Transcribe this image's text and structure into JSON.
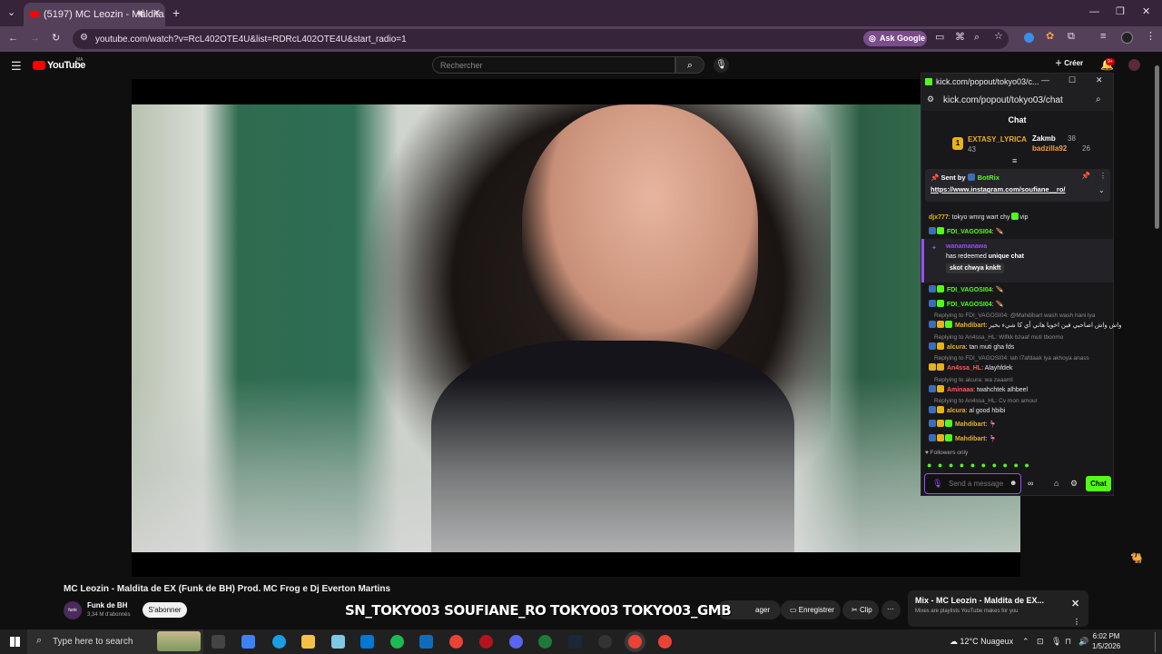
{
  "browser": {
    "tab_title": "(5197) MC Leozin - Maldita",
    "url": "youtube.com/watch?v=RcL402OTE4U&list=RDRcL402OTE4U&start_radio=1",
    "ask_google": "Ask Google",
    "new_tab": "+"
  },
  "youtube": {
    "logo": "YouTube",
    "region": "MA",
    "search_placeholder": "Rechercher",
    "create_label": "Créer",
    "notification_count": "9+"
  },
  "kick": {
    "window_title": "kick.com/popout/tokyo03/c...",
    "url": "kick.com/popout/tokyo03/chat",
    "chat_header": "Chat",
    "leaderboard": {
      "first": {
        "name": "EXTASY_LYRICA",
        "score": "43"
      },
      "second": {
        "name": "Zakmb",
        "score": "38"
      },
      "third": {
        "name": "badzilla92",
        "score": "26"
      },
      "rank_badge": "1"
    },
    "pinned": {
      "sent_by": "Sent by",
      "bot": "BotRix",
      "link": "https://www.instagram.com/soufiane__ro/"
    },
    "messages": {
      "m1_user": "djx777",
      "m1_text": ": tokyo wmrg wart chy",
      "m1_tail": "vip",
      "m2_user": "FDI_VAGOSI04",
      "redeem_user": "wanamanawa",
      "redeem_text": "has redeemed",
      "redeem_item": "unique chat",
      "redeem_msg": "skot chwya knkft",
      "m3_user": "FDI_VAGOSI04",
      "m4_user": "FDI_VAGOSI04",
      "r5": "Replying to FDI_VAGOSI04: @Mahdibart wash wash hani lya",
      "m5_user": "Mahdibart",
      "m5_text": ": واش واش اصاحبي فين اخويا هاني أي كا شيء بخير",
      "r6": "Replying to An4ssa_HL: Wlfkk bzaaf muti tbonmo",
      "m6_user": "alcura",
      "m6_text": ": tan muti gha fds",
      "r7": "Replying to FDI_VAGOSI04: lah l7afdaak lya akhoya anass",
      "m7_user": "An4ssa_HL",
      "m7_text": ": Alayhfdek",
      "r8": "Replying to alcura: wa zaaaml",
      "m8_user": "Aminaaa",
      "m8_text": ": twahchtek alhbeel",
      "r9": "Replying to An4ssa_HL: Cv mon amour",
      "m9_user": "alcura",
      "m9_text": ": al good hbibi",
      "m10_user": "Mahdibart",
      "m11_user": "Mahdibart"
    },
    "followers_only": "Followers only",
    "input_placeholder": "Send a message",
    "chat_button": "Chat"
  },
  "video": {
    "title": "MC Leozin - Maldita de EX (Funk de BH) Prod. MC Frog e Dj Everton Martins",
    "channel": "Funk de BH",
    "subscribers": "3,34 M d'abonnés",
    "subscribe": "S'abonner",
    "overlay_text": "SN_TOKYO03  SOUFIANE_RO  TOKYO03  TOKYO03_GMB",
    "share_tail": "ager",
    "save": "Enregistrer",
    "clip": "Clip"
  },
  "mix": {
    "title": "Mix - MC Leozin - Maldita de EX...",
    "subtitle": "Mixes are playlists YouTube makes for you"
  },
  "taskbar": {
    "search": "Type here to search",
    "weather": "12°C  Nuageux",
    "time": "6:02 PM",
    "date": "1/5/2026"
  }
}
